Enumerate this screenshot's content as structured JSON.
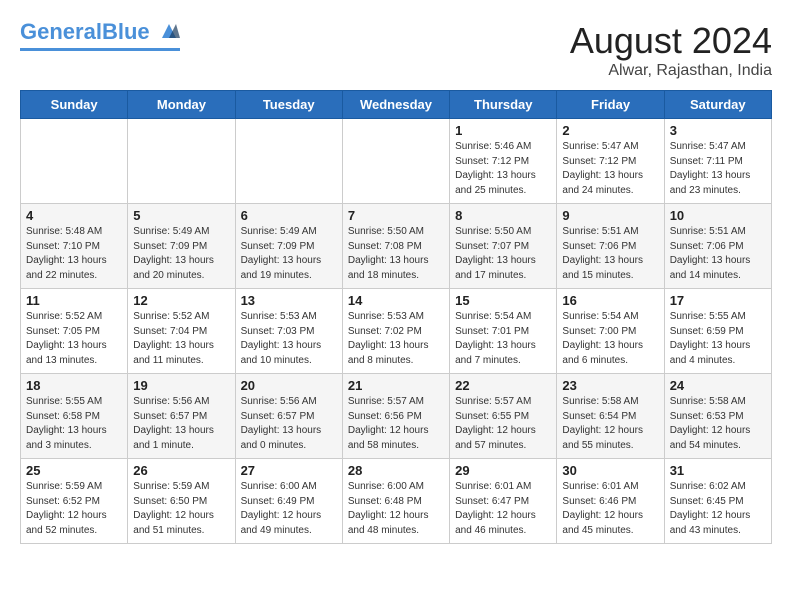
{
  "header": {
    "logo_general": "General",
    "logo_blue": "Blue",
    "month_year": "August 2024",
    "location": "Alwar, Rajasthan, India"
  },
  "days_of_week": [
    "Sunday",
    "Monday",
    "Tuesday",
    "Wednesday",
    "Thursday",
    "Friday",
    "Saturday"
  ],
  "weeks": [
    [
      {
        "day": "",
        "info": ""
      },
      {
        "day": "",
        "info": ""
      },
      {
        "day": "",
        "info": ""
      },
      {
        "day": "",
        "info": ""
      },
      {
        "day": "1",
        "info": "Sunrise: 5:46 AM\nSunset: 7:12 PM\nDaylight: 13 hours\nand 25 minutes."
      },
      {
        "day": "2",
        "info": "Sunrise: 5:47 AM\nSunset: 7:12 PM\nDaylight: 13 hours\nand 24 minutes."
      },
      {
        "day": "3",
        "info": "Sunrise: 5:47 AM\nSunset: 7:11 PM\nDaylight: 13 hours\nand 23 minutes."
      }
    ],
    [
      {
        "day": "4",
        "info": "Sunrise: 5:48 AM\nSunset: 7:10 PM\nDaylight: 13 hours\nand 22 minutes."
      },
      {
        "day": "5",
        "info": "Sunrise: 5:49 AM\nSunset: 7:09 PM\nDaylight: 13 hours\nand 20 minutes."
      },
      {
        "day": "6",
        "info": "Sunrise: 5:49 AM\nSunset: 7:09 PM\nDaylight: 13 hours\nand 19 minutes."
      },
      {
        "day": "7",
        "info": "Sunrise: 5:50 AM\nSunset: 7:08 PM\nDaylight: 13 hours\nand 18 minutes."
      },
      {
        "day": "8",
        "info": "Sunrise: 5:50 AM\nSunset: 7:07 PM\nDaylight: 13 hours\nand 17 minutes."
      },
      {
        "day": "9",
        "info": "Sunrise: 5:51 AM\nSunset: 7:06 PM\nDaylight: 13 hours\nand 15 minutes."
      },
      {
        "day": "10",
        "info": "Sunrise: 5:51 AM\nSunset: 7:06 PM\nDaylight: 13 hours\nand 14 minutes."
      }
    ],
    [
      {
        "day": "11",
        "info": "Sunrise: 5:52 AM\nSunset: 7:05 PM\nDaylight: 13 hours\nand 13 minutes."
      },
      {
        "day": "12",
        "info": "Sunrise: 5:52 AM\nSunset: 7:04 PM\nDaylight: 13 hours\nand 11 minutes."
      },
      {
        "day": "13",
        "info": "Sunrise: 5:53 AM\nSunset: 7:03 PM\nDaylight: 13 hours\nand 10 minutes."
      },
      {
        "day": "14",
        "info": "Sunrise: 5:53 AM\nSunset: 7:02 PM\nDaylight: 13 hours\nand 8 minutes."
      },
      {
        "day": "15",
        "info": "Sunrise: 5:54 AM\nSunset: 7:01 PM\nDaylight: 13 hours\nand 7 minutes."
      },
      {
        "day": "16",
        "info": "Sunrise: 5:54 AM\nSunset: 7:00 PM\nDaylight: 13 hours\nand 6 minutes."
      },
      {
        "day": "17",
        "info": "Sunrise: 5:55 AM\nSunset: 6:59 PM\nDaylight: 13 hours\nand 4 minutes."
      }
    ],
    [
      {
        "day": "18",
        "info": "Sunrise: 5:55 AM\nSunset: 6:58 PM\nDaylight: 13 hours\nand 3 minutes."
      },
      {
        "day": "19",
        "info": "Sunrise: 5:56 AM\nSunset: 6:57 PM\nDaylight: 13 hours\nand 1 minute."
      },
      {
        "day": "20",
        "info": "Sunrise: 5:56 AM\nSunset: 6:57 PM\nDaylight: 13 hours\nand 0 minutes."
      },
      {
        "day": "21",
        "info": "Sunrise: 5:57 AM\nSunset: 6:56 PM\nDaylight: 12 hours\nand 58 minutes."
      },
      {
        "day": "22",
        "info": "Sunrise: 5:57 AM\nSunset: 6:55 PM\nDaylight: 12 hours\nand 57 minutes."
      },
      {
        "day": "23",
        "info": "Sunrise: 5:58 AM\nSunset: 6:54 PM\nDaylight: 12 hours\nand 55 minutes."
      },
      {
        "day": "24",
        "info": "Sunrise: 5:58 AM\nSunset: 6:53 PM\nDaylight: 12 hours\nand 54 minutes."
      }
    ],
    [
      {
        "day": "25",
        "info": "Sunrise: 5:59 AM\nSunset: 6:52 PM\nDaylight: 12 hours\nand 52 minutes."
      },
      {
        "day": "26",
        "info": "Sunrise: 5:59 AM\nSunset: 6:50 PM\nDaylight: 12 hours\nand 51 minutes."
      },
      {
        "day": "27",
        "info": "Sunrise: 6:00 AM\nSunset: 6:49 PM\nDaylight: 12 hours\nand 49 minutes."
      },
      {
        "day": "28",
        "info": "Sunrise: 6:00 AM\nSunset: 6:48 PM\nDaylight: 12 hours\nand 48 minutes."
      },
      {
        "day": "29",
        "info": "Sunrise: 6:01 AM\nSunset: 6:47 PM\nDaylight: 12 hours\nand 46 minutes."
      },
      {
        "day": "30",
        "info": "Sunrise: 6:01 AM\nSunset: 6:46 PM\nDaylight: 12 hours\nand 45 minutes."
      },
      {
        "day": "31",
        "info": "Sunrise: 6:02 AM\nSunset: 6:45 PM\nDaylight: 12 hours\nand 43 minutes."
      }
    ]
  ]
}
